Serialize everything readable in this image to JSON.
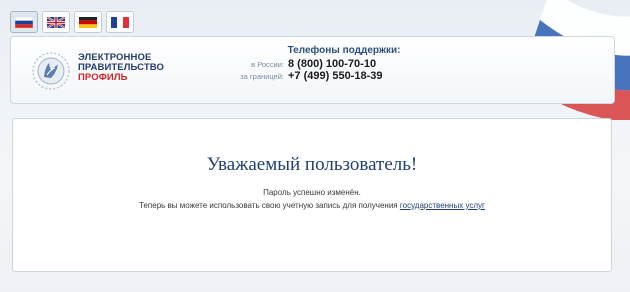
{
  "languages": [
    {
      "name": "Russian",
      "active": true
    },
    {
      "name": "English",
      "active": false
    },
    {
      "name": "German",
      "active": false
    },
    {
      "name": "French",
      "active": false
    }
  ],
  "colors": {
    "brand_blue": "#233c6e",
    "brand_red": "#d8232a",
    "link": "#1f3f73"
  },
  "header": {
    "logo_line1": "ЭЛЕКТРОННОЕ",
    "logo_line2": "ПРАВИТЕЛЬСТВО",
    "logo_line3": "ПРОФИЛЬ",
    "support_title": "Телефоны поддержки:",
    "phones": [
      {
        "label": "в России:",
        "number": "8 (800) 100-70-10"
      },
      {
        "label": "за границей:",
        "number": "+7 (499) 550-18-39"
      }
    ]
  },
  "main": {
    "greeting": "Уважаемый пользователь!",
    "message1": "Пароль успешно изменён.",
    "message2_prefix": "Теперь вы можете использовать свою учетную запись для получения ",
    "message2_link": "государственных услуг"
  }
}
